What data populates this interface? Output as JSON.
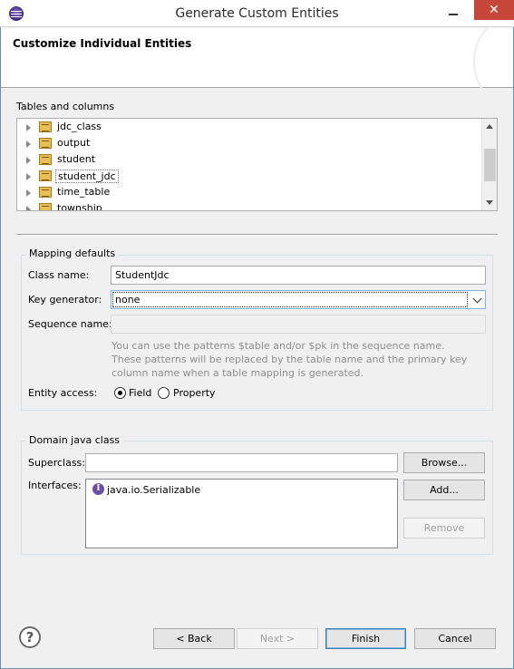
{
  "window": {
    "title": "Generate Custom Entities",
    "close_glyph": "✕"
  },
  "header": {
    "title": "Customize Individual Entities"
  },
  "tables": {
    "label": "Tables and columns",
    "items": [
      {
        "label": "jdc_class"
      },
      {
        "label": "output"
      },
      {
        "label": "student"
      },
      {
        "label": "student_jdc"
      },
      {
        "label": "time_table"
      },
      {
        "label": "township"
      }
    ]
  },
  "mapping": {
    "group_title": "Mapping defaults",
    "class_name_label": "Class name:",
    "class_name_value": "StudentJdc",
    "key_generator_label": "Key generator:",
    "key_generator_value": "none",
    "sequence_name_label": "Sequence name:",
    "sequence_name_value": "",
    "hint_line1": "You can use the patterns $table and/or $pk in the sequence name.",
    "hint_line2": "These patterns will be replaced by the table name and the primary key",
    "hint_line3": "column name when a table mapping is generated.",
    "entity_access_label": "Entity access:",
    "access_field": "Field",
    "access_property": "Property",
    "selected_access": "Field"
  },
  "domain": {
    "group_title": "Domain java class",
    "superclass_label": "Superclass:",
    "superclass_value": "",
    "browse_label": "Browse...",
    "interfaces_label": "Interfaces:",
    "interfaces": [
      {
        "name": "java.io.Serializable",
        "icon": "I"
      }
    ],
    "add_label": "Add...",
    "remove_label": "Remove"
  },
  "footer": {
    "help_glyph": "?",
    "back_label": "< Back",
    "next_label": "Next >",
    "finish_label": "Finish",
    "cancel_label": "Cancel"
  }
}
